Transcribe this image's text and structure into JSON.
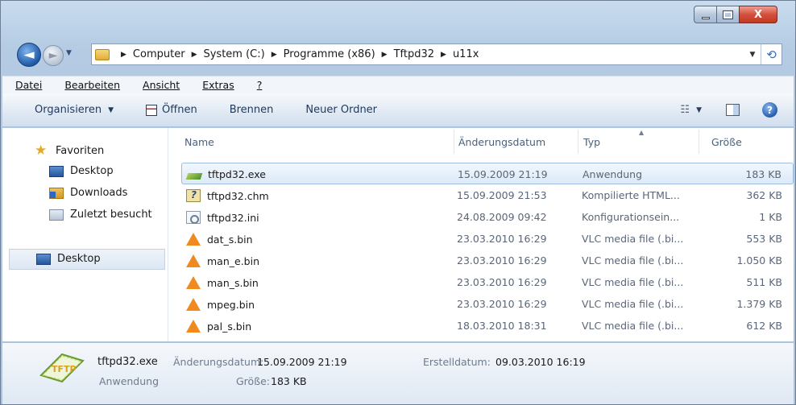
{
  "window": {
    "close_glyph": "X"
  },
  "nav": {
    "back_glyph": "◄",
    "forward_glyph": "►"
  },
  "address": {
    "segments": [
      "Computer",
      "System (C:)",
      "Programme (x86)",
      "Tftpd32",
      "u11x"
    ]
  },
  "menu": [
    "Datei",
    "Bearbeiten",
    "Ansicht",
    "Extras",
    "?"
  ],
  "toolbar": {
    "organize": "Organisieren",
    "open": "Öffnen",
    "burn": "Brennen",
    "new_folder": "Neuer Ordner"
  },
  "navpane": {
    "favorites": "Favoriten",
    "items": [
      "Desktop",
      "Downloads",
      "Zuletzt besucht"
    ],
    "desktop": "Desktop"
  },
  "columns": {
    "name": "Name",
    "date": "Änderungsdatum",
    "type": "Typ",
    "size": "Größe"
  },
  "files": [
    {
      "name": "tftpd32.exe",
      "date": "15.09.2009 21:19",
      "type": "Anwendung",
      "size": "183 KB",
      "icon": "app-icon",
      "selected": true
    },
    {
      "name": "tftpd32.chm",
      "date": "15.09.2009 21:53",
      "type": "Kompilierte HTML...",
      "size": "362 KB",
      "icon": "help-file-icon"
    },
    {
      "name": "tftpd32.ini",
      "date": "24.08.2009 09:42",
      "type": "Konfigurationsein...",
      "size": "1 KB",
      "icon": "settings-file-icon"
    },
    {
      "name": "dat_s.bin",
      "date": "23.03.2010 16:29",
      "type": "VLC media file (.bi...",
      "size": "553 KB",
      "icon": "vlc-icon"
    },
    {
      "name": "man_e.bin",
      "date": "23.03.2010 16:29",
      "type": "VLC media file (.bi...",
      "size": "1.050 KB",
      "icon": "vlc-icon"
    },
    {
      "name": "man_s.bin",
      "date": "23.03.2010 16:29",
      "type": "VLC media file (.bi...",
      "size": "511 KB",
      "icon": "vlc-icon"
    },
    {
      "name": "mpeg.bin",
      "date": "23.03.2010 16:29",
      "type": "VLC media file (.bi...",
      "size": "1.379 KB",
      "icon": "vlc-icon"
    },
    {
      "name": "pal_s.bin",
      "date": "18.03.2010 18:31",
      "type": "VLC media file (.bi...",
      "size": "612 KB",
      "icon": "vlc-icon"
    }
  ],
  "details": {
    "filename": "tftpd32.exe",
    "filetype": "Anwendung",
    "modified_label": "Änderungsdatum:",
    "modified_value": "15.09.2009 21:19",
    "size_label": "Größe:",
    "size_value": "183 KB",
    "created_label": "Erstelldatum:",
    "created_value": "09.03.2010 16:19",
    "logo_text": "TFTP"
  },
  "colors": {
    "selection": "#dce9f8",
    "accent": "#1f5aa8",
    "vlc": "#f08a1e"
  }
}
